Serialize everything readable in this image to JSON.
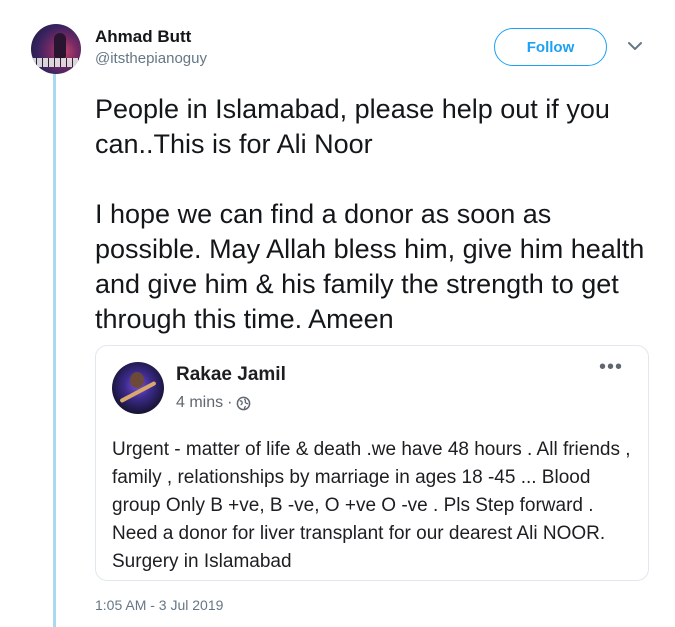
{
  "tweet": {
    "author": {
      "name": "Ahmad Butt",
      "handle": "@itsthepianoguy",
      "avatar_icon": "avatar-pianist"
    },
    "follow_label": "Follow",
    "caret_icon": "chevron-down-icon",
    "text_paragraph_1": "People in Islamabad, please help out if you can..This is for Ali Noor",
    "text_paragraph_2": "I hope we can find a donor as soon as possible. May Allah bless him, give him health and give him & his family the strength to get through this time. Ameen",
    "timestamp": "1:05 AM - 3 Jul 2019",
    "accent_color": "#1da1f2",
    "thread_line_color": "#a9d8f2"
  },
  "quoted_post": {
    "author": "Rakae Jamil",
    "time": "4 mins",
    "separator": "·",
    "privacy_icon": "globe-icon",
    "more_icon": "more-options-icon",
    "body": "Urgent - matter of life & death .we have 48 hours . All friends , family , relationships by marriage in ages 18 -45 ... Blood group Only B +ve, B -ve, O +ve O -ve . Pls Step forward . Need a donor for liver transplant  for our dearest Ali NOOR. Surgery in Islamabad"
  }
}
